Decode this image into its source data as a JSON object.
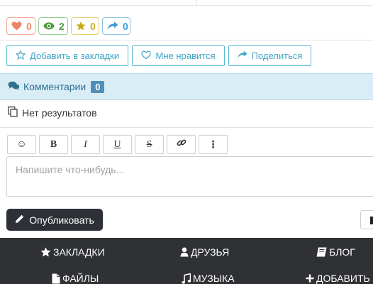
{
  "stats": {
    "likes": "0",
    "views": "2",
    "stars": "0",
    "shares": "0"
  },
  "actions": {
    "bookmark": "Добавить в закладки",
    "like": "Мне нравится",
    "share": "Поделиться"
  },
  "comments": {
    "title": "Комментарии",
    "count": "0"
  },
  "no_results": "Нет результатов",
  "editor": {
    "toolbar": [
      "☺",
      "B",
      "I",
      "U",
      "S",
      "🔗",
      "⋮"
    ],
    "placeholder": "Напишите что-нибудь..."
  },
  "publish_label": "Опубликовать",
  "footer": {
    "row1": [
      "ЗАКЛАДКИ",
      "ДРУЗЬЯ",
      "БЛОГ"
    ],
    "row2": [
      "ФАЙЛЫ",
      "МУЗЫКА",
      "ДОБАВИТЬ"
    ]
  },
  "colors": {
    "likes": "#ee8467",
    "views": "#4a9a3a",
    "stars": "#c9a816",
    "shares": "#3f9ad6",
    "accent": "#3fa6c5",
    "footer_bg": "#2f3135"
  }
}
